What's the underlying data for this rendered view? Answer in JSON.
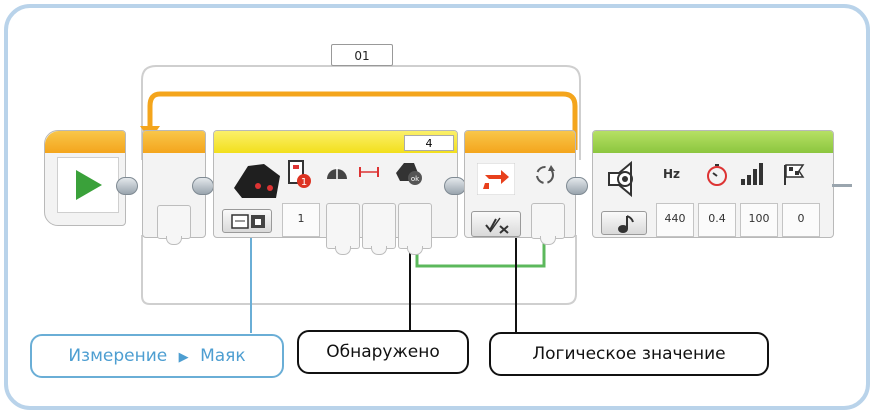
{
  "loop": {
    "counter_label": "01"
  },
  "switch": {
    "case_label": "4",
    "value": "1"
  },
  "sound": {
    "hz_label": "Hz",
    "values": [
      "440",
      "0.4",
      "100",
      "0"
    ]
  },
  "callouts": {
    "measure_part1": "Измерение",
    "measure_arrow": "▶",
    "measure_part2": "Маяк",
    "detected": "Обнаружено",
    "logic": "Логическое значение"
  },
  "colors": {
    "loop_orange": "#f4a51c",
    "switch_yellow": "#f6e62a",
    "flow_green": "#8cc63f",
    "start_green": "#3aa13a",
    "wire_green": "#5cb85c",
    "callout_blue": "#6aaed6"
  },
  "icons": [
    "start-arrow-icon",
    "infrared-sensor-icon",
    "port-1-icon",
    "beacon-heading-icon",
    "proximity-icon",
    "detected-icon",
    "mode-measure-beacon-icon",
    "loop-arrows-icon",
    "compare-icon",
    "logic-mode-icon",
    "speaker-icon",
    "note-icon",
    "timer-icon",
    "volume-icon",
    "flag-icon"
  ]
}
